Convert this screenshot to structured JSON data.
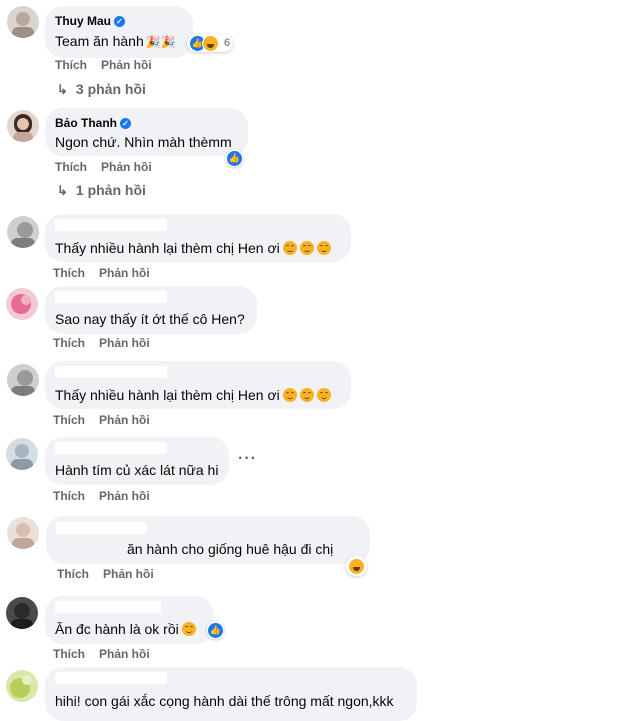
{
  "actions": {
    "like": "Thích",
    "reply": "Phản hồi"
  },
  "colors": {
    "bubble": "#f0f2f5",
    "action_text": "#65676b",
    "verified": "#1877f2"
  },
  "comments": [
    {
      "author": "Thuy Mau",
      "verified": true,
      "text": "Team ăn hành",
      "reactions": "6",
      "replies": "3 phản hồi"
    },
    {
      "author": "Bảo Thanh",
      "verified": true,
      "text": "Ngon chứ. Nhìn màh thèmm",
      "replies": "1 phản hồi"
    },
    {
      "text": "Thấy nhiều hành lại thèm chị Hen ơi"
    },
    {
      "text": "Sao nay thấy ít ớt thế cô Hen?"
    },
    {
      "text": "Thấy nhiều hành lại thèm chị Hen ơi"
    },
    {
      "text": "Hành tím củ xác lát nữa hi"
    },
    {
      "text": "ăn hành cho giống huê hậu đi chị"
    },
    {
      "text": "Ăn đc hành là ok rồi"
    },
    {
      "text": "hihi! con gái xắc cọng hành dài thế trông mất ngon,kkk"
    }
  ]
}
